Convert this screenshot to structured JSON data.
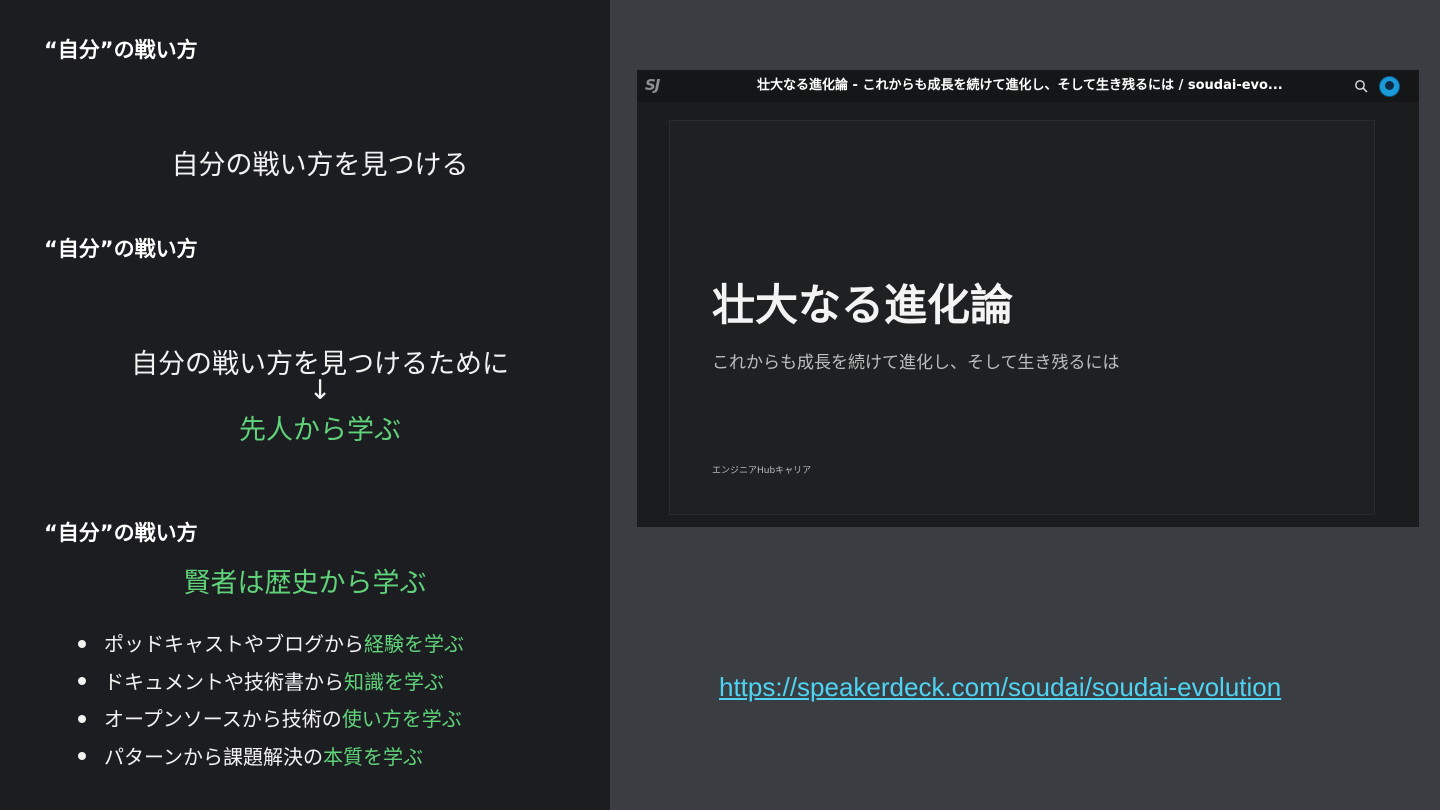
{
  "left": {
    "section1": {
      "heading": "“自分”の戦い方",
      "body": "自分の戦い方を見つける"
    },
    "section2": {
      "heading": "“自分”の戦い方",
      "line1": "自分の戦い方を見つけるために",
      "arrow": "↓",
      "line2": "先人から学ぶ"
    },
    "section3": {
      "heading": "“自分”の戦い方",
      "subheading": "賢者は歴史から学ぶ",
      "bullets": [
        {
          "plain": "ポッドキャストやブログから",
          "highlight": "経験を学ぶ"
        },
        {
          "plain": "ドキュメントや技術書から",
          "highlight": "知識を学ぶ"
        },
        {
          "plain": "オープンソースから技術の",
          "highlight": "使い方を学ぶ"
        },
        {
          "plain": "パターンから課題解決の",
          "highlight": "本質を学ぶ"
        }
      ]
    }
  },
  "right": {
    "screenshot": {
      "logo": "SJ",
      "title": "壮大なる進化論 - これからも成長を続けて進化し、そして生き残るには / soudai-evo...",
      "icons": [
        "search-icon",
        "avatar"
      ],
      "slide": {
        "title": "壮大なる進化論",
        "subtitle": "これからも成長を続けて進化し、そして生き残るには",
        "footer": "エンジニアHubキャリア"
      }
    },
    "link": "https://speakerdeck.com/soudai/soudai-evolution"
  },
  "colors": {
    "left_bg": "#1c1d20",
    "right_bg": "#3a3d42",
    "accent_green": "#5fd27a",
    "link_blue": "#4fd3f2"
  }
}
